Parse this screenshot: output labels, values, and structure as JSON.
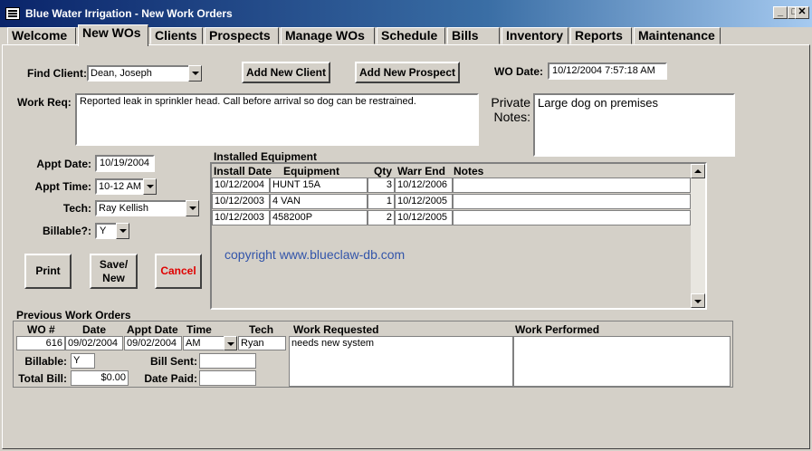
{
  "window": {
    "title": "Blue Water Irrigation - New Work Orders"
  },
  "tabs": [
    "Welcome",
    "New WOs",
    "Clients",
    "Prospects",
    "Manage WOs",
    "Schedule",
    "Bills",
    "Inventory",
    "Reports",
    "Maintenance"
  ],
  "form": {
    "find_client_label": "Find Client:",
    "find_client_value": "Dean, Joseph",
    "add_client_label": "Add New Client",
    "add_prospect_label": "Add New Prospect",
    "wo_date_label": "WO Date:",
    "wo_date_value": "10/12/2004 7:57:18 AM",
    "work_req_label": "Work Req:",
    "work_req_value": "Reported leak in sprinkler head.  Call before arrival so dog can be restrained.",
    "private_notes_label_1": "Private",
    "private_notes_label_2": "Notes:",
    "private_notes_value": "Large dog on premises",
    "appt_date_label": "Appt Date:",
    "appt_date_value": "10/19/2004",
    "appt_time_label": "Appt Time:",
    "appt_time_value": "10-12 AM",
    "tech_label": "Tech:",
    "tech_value": "Ray Kellish",
    "billable_label": "Billable?:",
    "billable_value": "Y",
    "print_label": "Print",
    "save_label_1": "Save/",
    "save_label_2": "New",
    "cancel_label": "Cancel"
  },
  "equipment": {
    "title": "Installed Equipment",
    "headers": {
      "install_date": "Install Date",
      "equipment": "Equipment",
      "qty": "Qty",
      "warr_end": "Warr End",
      "notes": "Notes"
    },
    "rows": [
      {
        "install_date": "10/12/2004",
        "equipment": "HUNT 15A",
        "qty": "3",
        "warr_end": "10/12/2006",
        "notes": ""
      },
      {
        "install_date": "10/12/2003",
        "equipment": "4 VAN",
        "qty": "1",
        "warr_end": "10/12/2005",
        "notes": ""
      },
      {
        "install_date": "10/12/2003",
        "equipment": "458200P",
        "qty": "2",
        "warr_end": "10/12/2005",
        "notes": ""
      }
    ],
    "copyright": "copyright www.blueclaw-db.com"
  },
  "previous": {
    "title": "Previous Work Orders",
    "headers": {
      "wo_no": "WO #",
      "date": "Date",
      "appt_date": "Appt Date",
      "time": "Time",
      "tech": "Tech",
      "work_requested": "Work Requested",
      "work_performed": "Work Performed"
    },
    "row": {
      "wo_no": "616",
      "date": "09/02/2004",
      "appt_date": "09/02/2004",
      "time": "AM",
      "tech": "Ryan",
      "work_requested": "needs new system",
      "work_performed": "",
      "billable_label": "Billable:",
      "billable_value": "Y",
      "bill_sent_label": "Bill Sent:",
      "bill_sent_value": "",
      "total_bill_label": "Total Bill:",
      "total_bill_value": "$0.00",
      "date_paid_label": "Date Paid:",
      "date_paid_value": ""
    }
  },
  "colors": {
    "titlebar": "#0a246a",
    "copyright": "#3355aa",
    "cancel": "#e00000"
  }
}
